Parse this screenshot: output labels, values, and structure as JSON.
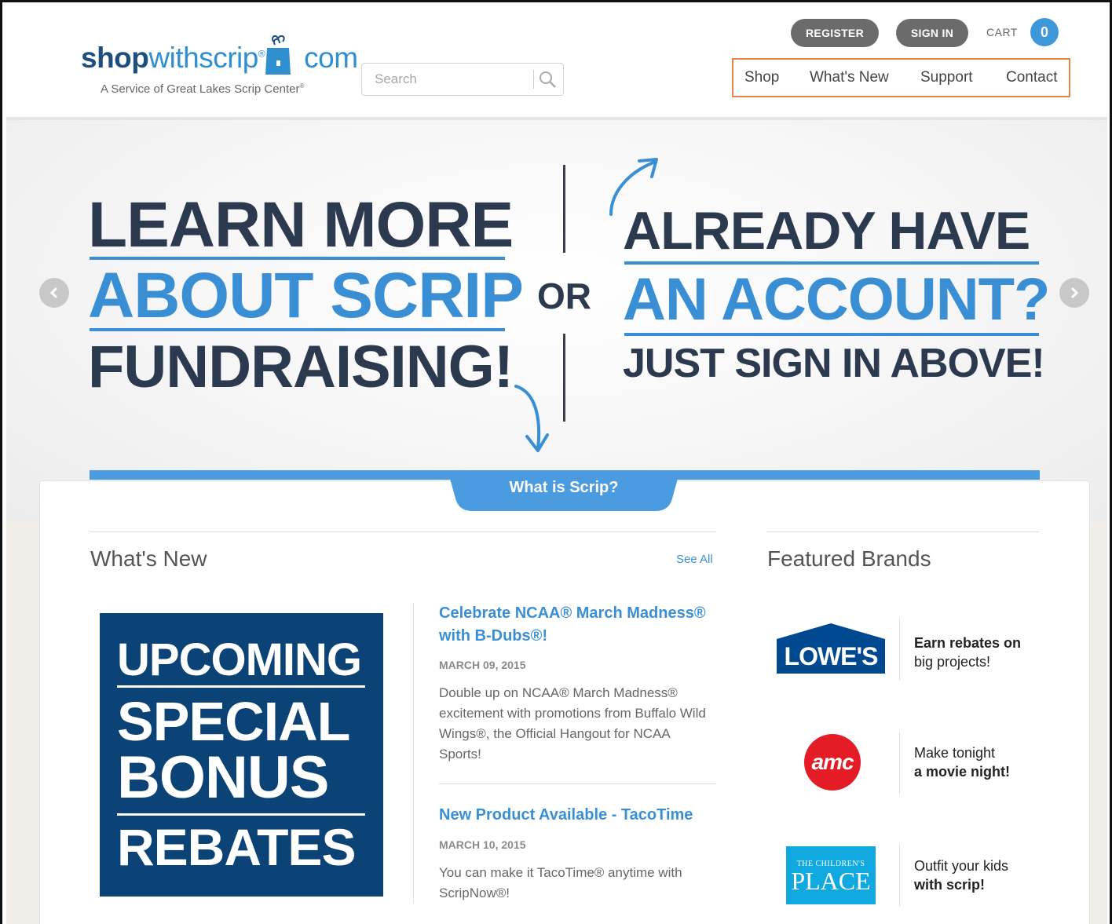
{
  "header": {
    "logo": {
      "part_shop": "shop",
      "part_with": "withscrip",
      "part_reg": "®",
      "part_com": "com",
      "subtitle": "A Service of Great Lakes Scrip Center",
      "subtitle_reg": "®"
    },
    "search": {
      "placeholder": "Search"
    },
    "register_label": "REGISTER",
    "signin_label": "SIGN IN",
    "cart_label": "CART",
    "cart_count": "0",
    "nav": [
      "Shop",
      "What's New",
      "Support",
      "Contact"
    ]
  },
  "hero": {
    "left_line1": "LEARN MORE",
    "left_line2": "ABOUT SCRIP",
    "left_line3": "FUNDRAISING!",
    "or_label": "OR",
    "right_line1": "ALREADY HAVE",
    "right_line2": "AN ACCOUNT?",
    "right_line3": "JUST SIGN IN ABOVE!"
  },
  "tab_label": "What is Scrip?",
  "whats_new": {
    "title": "What's New",
    "see_all": "See All",
    "promo": [
      "UPCOMING",
      "SPECIAL",
      "BONUS",
      "REBATES"
    ],
    "items": [
      {
        "title": "Celebrate NCAA® March Madness® with B-Dubs®!",
        "date": "MARCH 09, 2015",
        "body": "Double up on NCAA® March Madness® excitement with promotions from Buffalo Wild Wings®, the Official Hangout for NCAA Sports!"
      },
      {
        "title": "New Product Available - TacoTime",
        "date": "MARCH 10, 2015",
        "body": "You can make it TacoTime® anytime with ScripNow®!"
      }
    ]
  },
  "featured": {
    "title": "Featured Brands",
    "brands": [
      {
        "logo_text": "LOWE'S",
        "line1": "Earn rebates on",
        "line2": "big projects!",
        "bold_line": 1,
        "color": "#004990"
      },
      {
        "logo_text": "amc",
        "line1": "Make tonight",
        "line2": "a movie night!",
        "bold_line": 2,
        "color": "#e31c25"
      },
      {
        "logo_top": "THE CHILDREN'S",
        "logo_text": "PLACE",
        "line1": "Outfit your kids",
        "line2": "with scrip!",
        "bold_line": 2,
        "color": "#0fa9e0"
      }
    ]
  }
}
